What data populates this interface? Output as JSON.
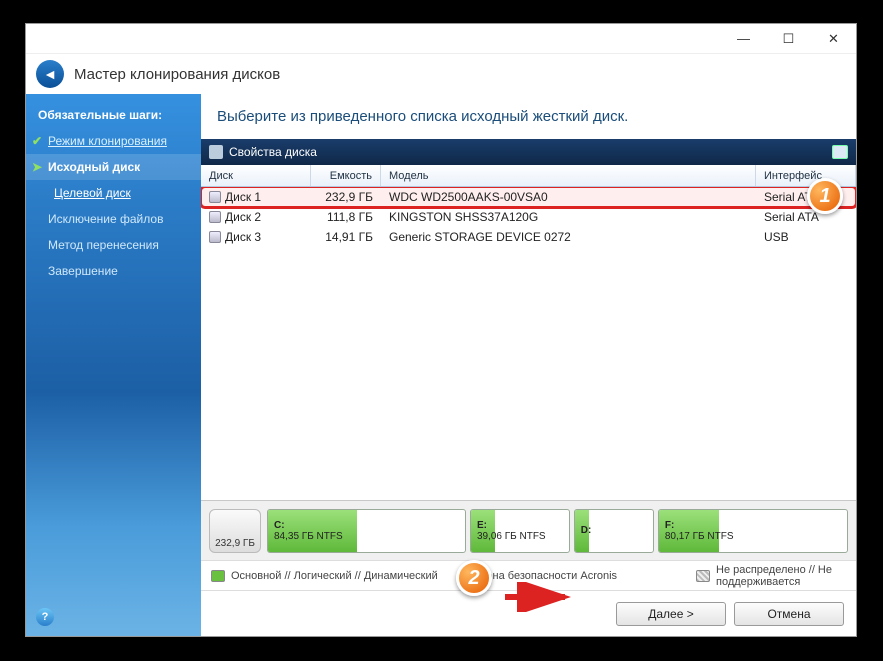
{
  "window": {
    "title": "Мастер клонирования дисков"
  },
  "sidebar": {
    "heading": "Обязательные шаги:",
    "steps": [
      {
        "label": "Режим клонирования",
        "state": "done"
      },
      {
        "label": "Исходный диск",
        "state": "active"
      },
      {
        "label": "Целевой диск",
        "state": "next"
      },
      {
        "label": "Исключение файлов",
        "state": "future"
      },
      {
        "label": "Метод перенесения",
        "state": "future"
      },
      {
        "label": "Завершение",
        "state": "future"
      }
    ]
  },
  "main": {
    "instruction": "Выберите из приведенного списка исходный жесткий диск.",
    "panel_title": "Свойства диска",
    "columns": {
      "disk": "Диск",
      "capacity": "Емкость",
      "model": "Модель",
      "interface": "Интерфейс"
    },
    "rows": [
      {
        "name": "Диск 1",
        "capacity": "232,9 ГБ",
        "model": "WDC WD2500AAKS-00VSA0",
        "interface": "Serial ATA",
        "selected": true
      },
      {
        "name": "Диск 2",
        "capacity": "111,8 ГБ",
        "model": "KINGSTON SHSS37A120G",
        "interface": "Serial ATA",
        "selected": false
      },
      {
        "name": "Диск 3",
        "capacity": "14,91 ГБ",
        "model": "Generic STORAGE DEVICE 0272",
        "interface": "USB",
        "selected": false
      }
    ],
    "disk_total": "232,9 ГБ",
    "partitions": [
      {
        "letter": "C:",
        "size": "84,35 ГБ  NTFS",
        "fill": 45,
        "flex": 84
      },
      {
        "letter": "E:",
        "size": "39,06 ГБ  NTFS",
        "fill": 25,
        "flex": 39
      },
      {
        "letter": "D:",
        "size": "",
        "fill": 18,
        "flex": 30
      },
      {
        "letter": "F:",
        "size": "80,17 ГБ  NTFS",
        "fill": 32,
        "flex": 80
      }
    ],
    "legend": {
      "primary": "Основной // Логический // Динамический",
      "acronis": "Зона безопасности Acronis",
      "unalloc": "Не распределено // Не поддерживается"
    }
  },
  "footer": {
    "next": "Далее >",
    "cancel": "Отмена"
  },
  "annotations": {
    "one": "1",
    "two": "2"
  }
}
